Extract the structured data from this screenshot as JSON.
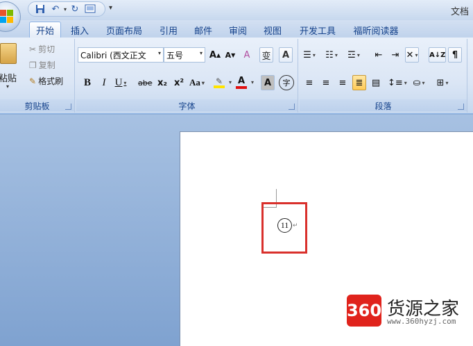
{
  "window": {
    "title": "文档"
  },
  "quick_access": {
    "save_icon": "save-icon",
    "undo_icon": "undo-icon",
    "redo_icon": "redo-icon",
    "print_preview_icon": "print-preview-icon",
    "customize_icon": "customize-qat-icon"
  },
  "tabs": [
    "开始",
    "插入",
    "页面布局",
    "引用",
    "邮件",
    "审阅",
    "视图",
    "开发工具",
    "福昕阅读器"
  ],
  "active_tab": "开始",
  "clipboard": {
    "label": "剪贴板",
    "paste": "粘贴",
    "cut": "剪切",
    "copy": "复制",
    "format_painter": "格式刷"
  },
  "font": {
    "label": "字体",
    "font_name": "Calibri (西文正文",
    "font_size": "五号",
    "grow": "A",
    "shrink": "A",
    "clear_format": "A",
    "phonetic": "变",
    "char_border": "A",
    "bold": "B",
    "italic": "I",
    "underline": "U",
    "strikethrough": "abe",
    "subscript": "x₂",
    "superscript": "x²",
    "change_case": "Aa",
    "font_color": "A",
    "char_shading": "A",
    "enclose_char": "字"
  },
  "paragraph": {
    "label": "段落"
  },
  "document": {
    "enclosed_char": "11",
    "paragraph_mark": "↵"
  },
  "watermark": {
    "badge": "360",
    "text": "货源之家",
    "url": "www.360hyzj.com"
  },
  "colors": {
    "accent": "#15428b",
    "highlight_box": "#d9302c",
    "watermark_red": "#e0231c",
    "font_color_red": "#e01010",
    "highlight_yellow": "#ffe400"
  }
}
